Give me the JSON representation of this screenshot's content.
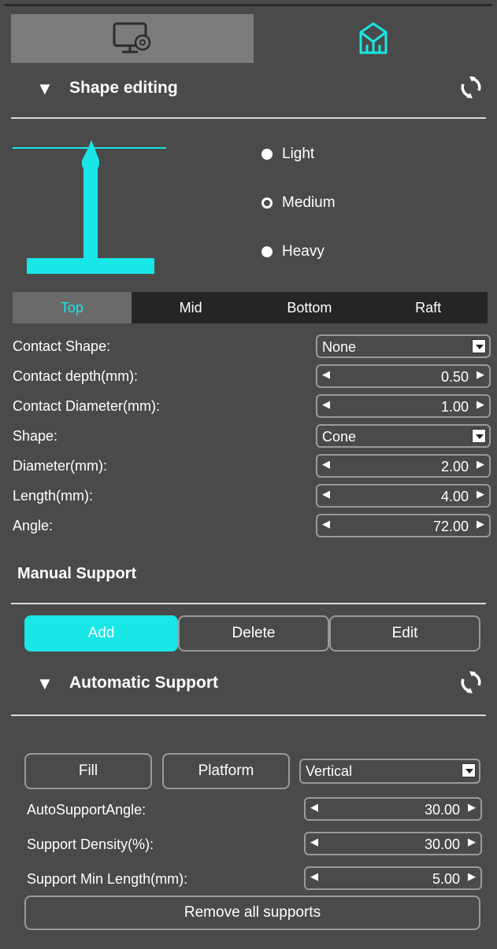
{
  "colors": {
    "accent": "#19e6e6",
    "panel": "#4a4a4a",
    "active_tab": "#7b7b7b"
  },
  "top_tabs": [
    {
      "icon": "settings-monitor-icon"
    },
    {
      "icon": "model-support-icon"
    }
  ],
  "shape_editing": {
    "title": "Shape editing",
    "presets": [
      {
        "label": "Light",
        "selected": false
      },
      {
        "label": "Medium",
        "selected": true
      },
      {
        "label": "Heavy",
        "selected": false
      }
    ],
    "tabs": [
      {
        "label": "Top",
        "active": true
      },
      {
        "label": "Mid",
        "active": false
      },
      {
        "label": "Bottom",
        "active": false
      },
      {
        "label": "Raft",
        "active": false
      }
    ],
    "properties": [
      {
        "label": "Contact Shape:",
        "type": "select",
        "value": "None"
      },
      {
        "label": "Contact depth(mm):",
        "type": "spin",
        "value": "0.50"
      },
      {
        "label": "Contact Diameter(mm):",
        "type": "spin",
        "value": "1.00"
      },
      {
        "label": "Shape:",
        "type": "select",
        "value": "Cone"
      },
      {
        "label": "Diameter(mm):",
        "type": "spin",
        "value": "2.00"
      },
      {
        "label": "Length(mm):",
        "type": "spin",
        "value": "4.00"
      },
      {
        "label": "Angle:",
        "type": "spin",
        "value": "72.00"
      }
    ]
  },
  "manual_support": {
    "title": "Manual Support",
    "buttons": {
      "add": "Add",
      "delete": "Delete",
      "edit": "Edit"
    }
  },
  "automatic_support": {
    "title": "Automatic Support",
    "fill": "Fill",
    "platform": "Platform",
    "direction": "Vertical",
    "properties": [
      {
        "label": "AutoSupportAngle:",
        "value": "30.00"
      },
      {
        "label": "Support Density(%):",
        "value": "30.00"
      },
      {
        "label": "Support Min Length(mm):",
        "value": "5.00"
      }
    ],
    "remove_all": "Remove all supports"
  }
}
